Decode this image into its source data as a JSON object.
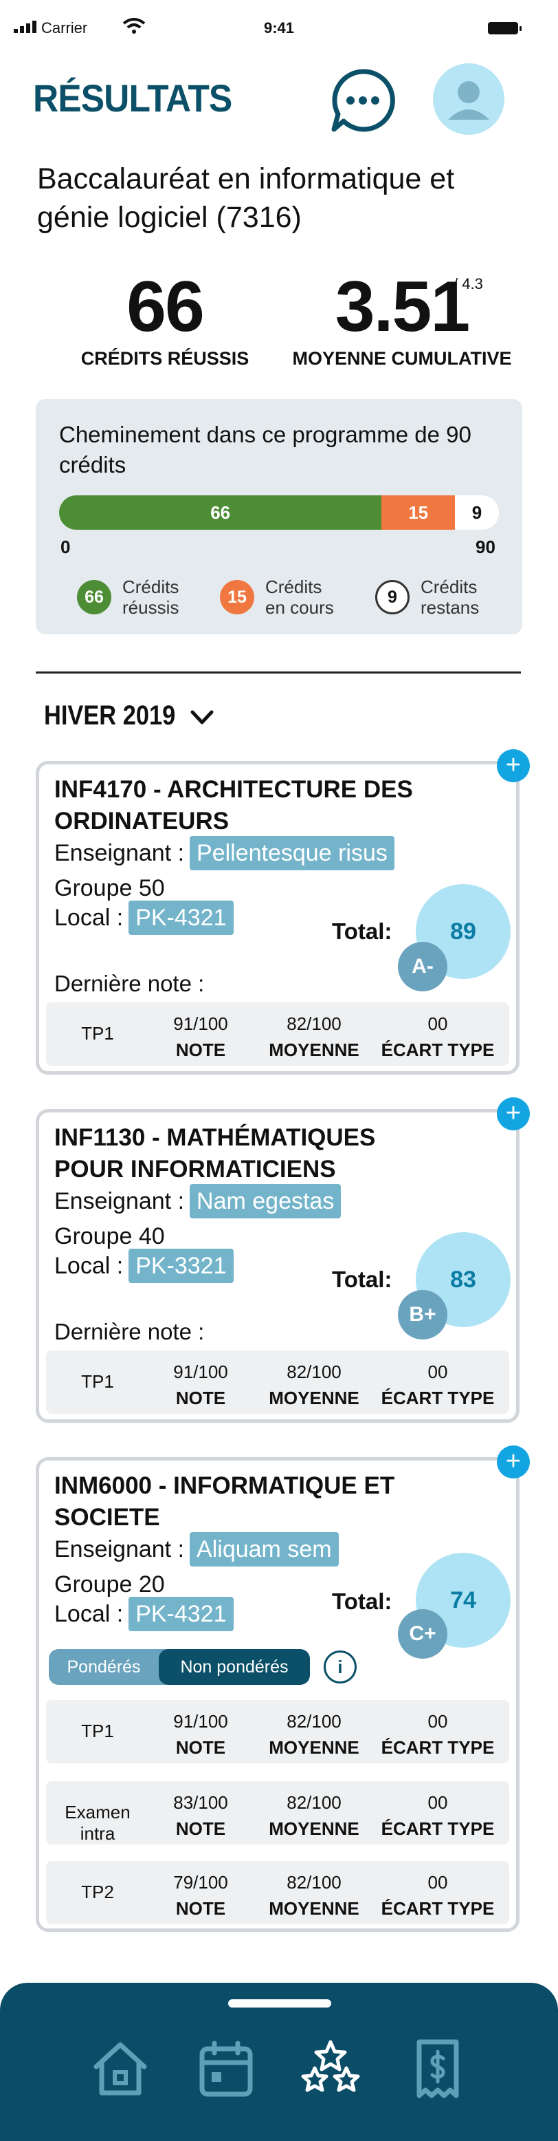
{
  "status_bar": {
    "carrier": "Carrier",
    "time": "9:41"
  },
  "header": {
    "title": "RÉSULTATS"
  },
  "program": {
    "title": "Baccalauréat en informatique et génie logiciel (7316)"
  },
  "stats": {
    "credits_value": "66",
    "credits_label": "CRÉDITS RÉUSSIS",
    "gpa_value": "3.51",
    "gpa_max": "/ 4.3",
    "gpa_label": "MOYENNE CUMULATIVE"
  },
  "progress": {
    "title": "Cheminement dans ce programme de 90 crédits",
    "min_label": "0",
    "max_label": "90",
    "total": 90,
    "segments": [
      {
        "value": 66,
        "label": "66",
        "color": "#4c8d35"
      },
      {
        "value": 15,
        "label": "15",
        "color": "#f0773f"
      },
      {
        "value": 9,
        "label": "9",
        "color": "#ffffff"
      }
    ],
    "legend": [
      {
        "value": "66",
        "line1": "Crédits",
        "line2": "réussis",
        "color": "#4c8d35"
      },
      {
        "value": "15",
        "line1": "Crédits",
        "line2": "en cours",
        "color": "#f0773f"
      },
      {
        "value": "9",
        "line1": "Crédits",
        "line2": "restans",
        "color": "#ffffff"
      }
    ]
  },
  "term": {
    "label": "HIVER 2019"
  },
  "courses": [
    {
      "title": "INF4170 - ARCHITECTURE DES ORDINATEURS",
      "teacher_label": "Enseignant :",
      "teacher": "Pellentesque risus",
      "group_label": "Groupe",
      "group": "50",
      "room_label": "Local :",
      "room": "PK-4321",
      "total_label": "Total:",
      "score": "89",
      "grade": "A-",
      "last_note_label": "Dernière note :",
      "evaluations": [
        {
          "name": "TP1",
          "note": "91/100",
          "note_label": "NOTE",
          "avg": "82/100",
          "avg_label": "MOYENNE",
          "std": "00",
          "std_label": "ÉCART TYPE"
        }
      ]
    },
    {
      "title": "INF1130 - MATHÉMATIQUES POUR INFORMATICIENS",
      "teacher_label": "Enseignant :",
      "teacher": "Nam egestas",
      "group_label": "Groupe",
      "group": "40",
      "room_label": "Local :",
      "room": "PK-3321",
      "total_label": "Total:",
      "score": "83",
      "grade": "B+",
      "last_note_label": "Dernière note :",
      "evaluations": [
        {
          "name": "TP1",
          "note": "91/100",
          "note_label": "NOTE",
          "avg": "82/100",
          "avg_label": "MOYENNE",
          "std": "00",
          "std_label": "ÉCART TYPE"
        }
      ]
    },
    {
      "title": "INM6000 - INFORMATIQUE ET SOCIETE",
      "teacher_label": "Enseignant :",
      "teacher": "Aliquam sem",
      "group_label": "Groupe",
      "group": "20",
      "room_label": "Local :",
      "room": "PK-4321",
      "total_label": "Total:",
      "score": "74",
      "grade": "C+",
      "toggle": {
        "weighted": "Pondérés",
        "unweighted": "Non pondérés"
      },
      "evaluations": [
        {
          "name": "TP1",
          "note": "91/100",
          "note_label": "NOTE",
          "avg": "82/100",
          "avg_label": "MOYENNE",
          "std": "00",
          "std_label": "ÉCART TYPE"
        },
        {
          "name": "Examen intra",
          "note": "83/100",
          "note_label": "NOTE",
          "avg": "82/100",
          "avg_label": "MOYENNE",
          "std": "00",
          "std_label": "ÉCART TYPE"
        },
        {
          "name": "TP2",
          "note": "79/100",
          "note_label": "NOTE",
          "avg": "82/100",
          "avg_label": "MOYENNE",
          "std": "00",
          "std_label": "ÉCART TYPE"
        }
      ]
    }
  ],
  "nav": {
    "items": [
      {
        "icon": "home-icon"
      },
      {
        "icon": "calendar-icon"
      },
      {
        "icon": "stars-icon"
      },
      {
        "icon": "receipt-icon"
      }
    ]
  }
}
